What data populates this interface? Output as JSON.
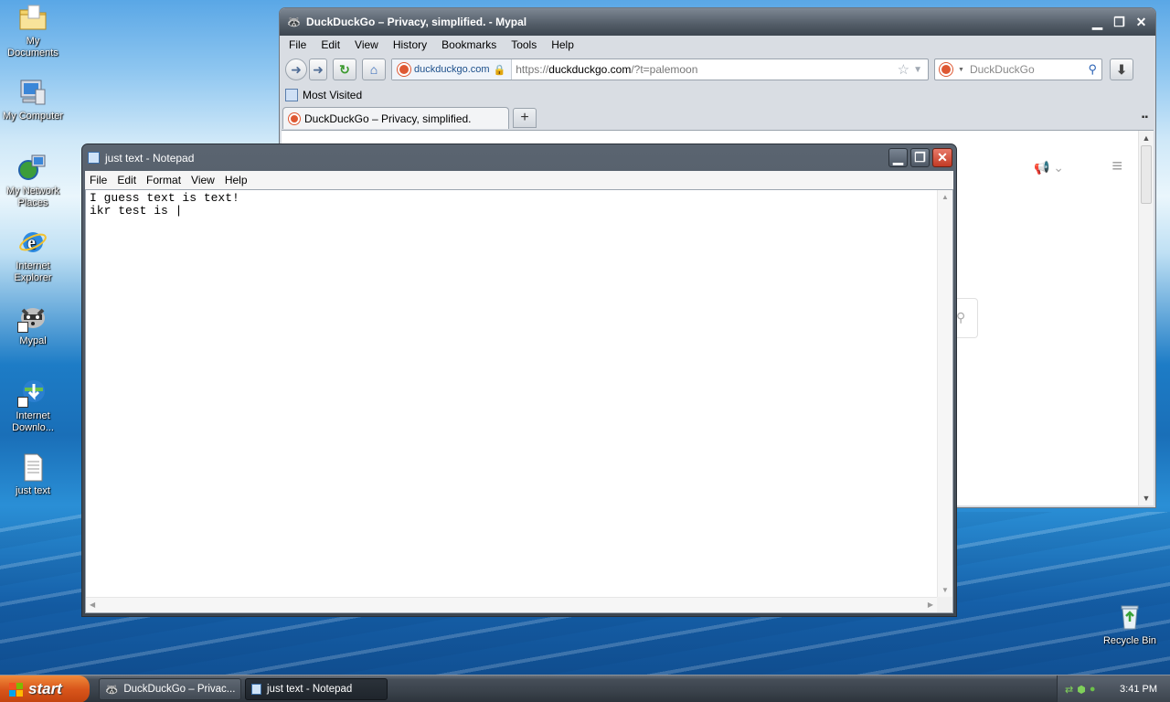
{
  "desktop": {
    "icons": [
      {
        "label": "My Documents"
      },
      {
        "label": "My Computer"
      },
      {
        "label": "My Network Places"
      },
      {
        "label": "Internet Explorer"
      },
      {
        "label": "Mypal"
      },
      {
        "label": "Internet Downlo..."
      },
      {
        "label": "just text"
      }
    ],
    "recycle_bin": {
      "label": "Recycle Bin"
    }
  },
  "browser": {
    "title": "DuckDuckGo – Privacy, simplified. - Mypal",
    "menu": [
      "File",
      "Edit",
      "View",
      "History",
      "Bookmarks",
      "Tools",
      "Help"
    ],
    "identity_label": "duckduckgo.com",
    "url_prefix": "https://",
    "url_domain": "duckduckgo.com",
    "url_path": "/?t=palemoon",
    "search_placeholder": "DuckDuckGo",
    "bookmarks": [
      {
        "label": "Most Visited"
      }
    ],
    "tabs": [
      {
        "label": "DuckDuckGo – Privacy, simplified."
      }
    ],
    "new_tab_symbol": "+"
  },
  "notepad": {
    "title": "just text - Notepad",
    "menu": [
      "File",
      "Edit",
      "Format",
      "View",
      "Help"
    ],
    "content": "I guess text is text!\nikr test is |"
  },
  "taskbar": {
    "start_label": "start",
    "tasks": [
      {
        "label": "DuckDuckGo – Privac...",
        "active": false
      },
      {
        "label": "just text - Notepad",
        "active": true
      }
    ],
    "clock": "3:41 PM"
  },
  "colors": {
    "ddg_orange": "#de5833",
    "start_orange": "#d9561b",
    "close_red": "#c23a24"
  }
}
